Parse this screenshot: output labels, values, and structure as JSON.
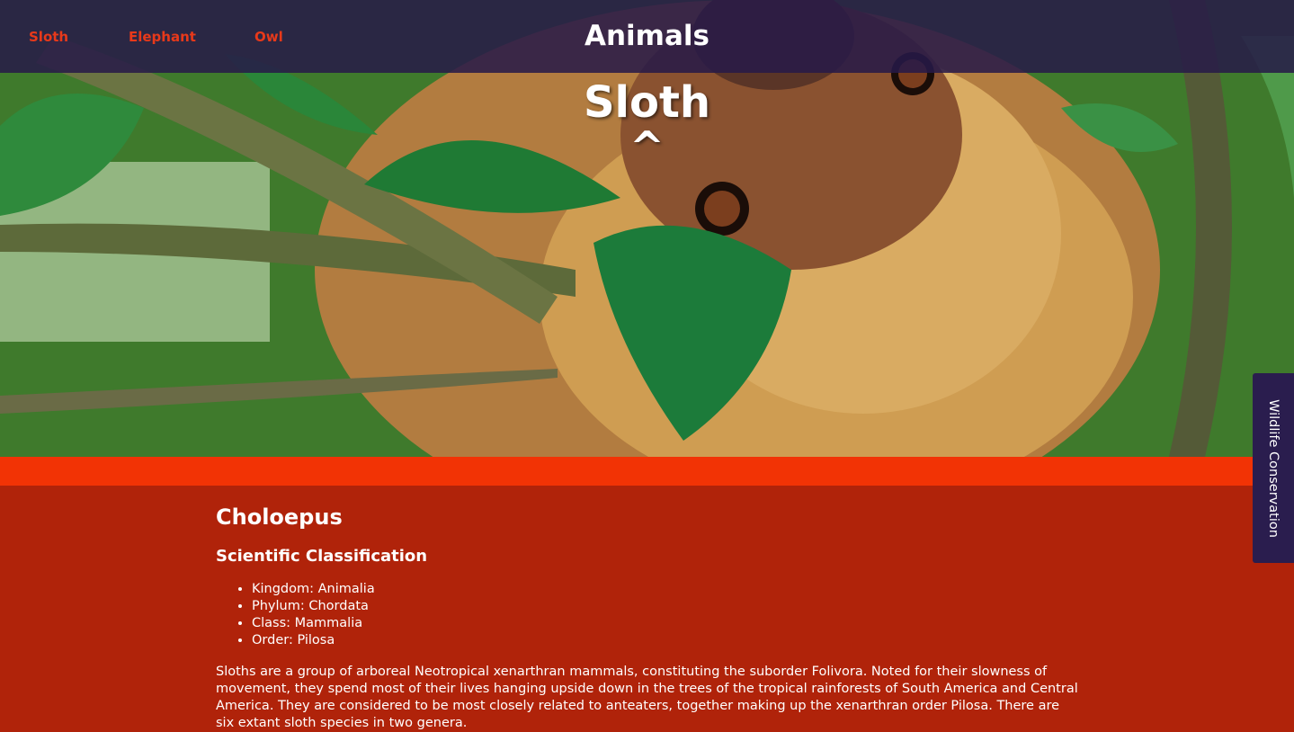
{
  "header": {
    "nav": [
      {
        "label": "Sloth"
      },
      {
        "label": "Elephant"
      },
      {
        "label": "Owl"
      }
    ],
    "title": "Animals"
  },
  "hero": {
    "title": "Sloth",
    "scroll_up_glyph": "^",
    "photo_subject": "sloth-photo"
  },
  "content": {
    "genus": "Choloepus",
    "classification_heading": "Scientific Classification",
    "classification": [
      "Kingdom: Animalia",
      "Phylum: Chordata",
      "Class: Mammalia",
      "Order: Pilosa"
    ],
    "description": "Sloths are a group of arboreal Neotropical xenarthran mammals, constituting the suborder Folivora. Noted for their slowness of movement, they spend most of their lives hanging upside down in the trees of the tropical rainforests of South America and Central America. They are considered to be most closely related to anteaters, together making up the xenarthran order Pilosa. There are six extant sloth species in two genera."
  },
  "side_tab": {
    "label": "Wildlife Conservation"
  },
  "colors": {
    "header_bg": "#261a48",
    "nav_link": "#e8391a",
    "strip": "#f23305",
    "content_bg": "#b0230a",
    "side_tab_bg": "#2a1d4e"
  }
}
